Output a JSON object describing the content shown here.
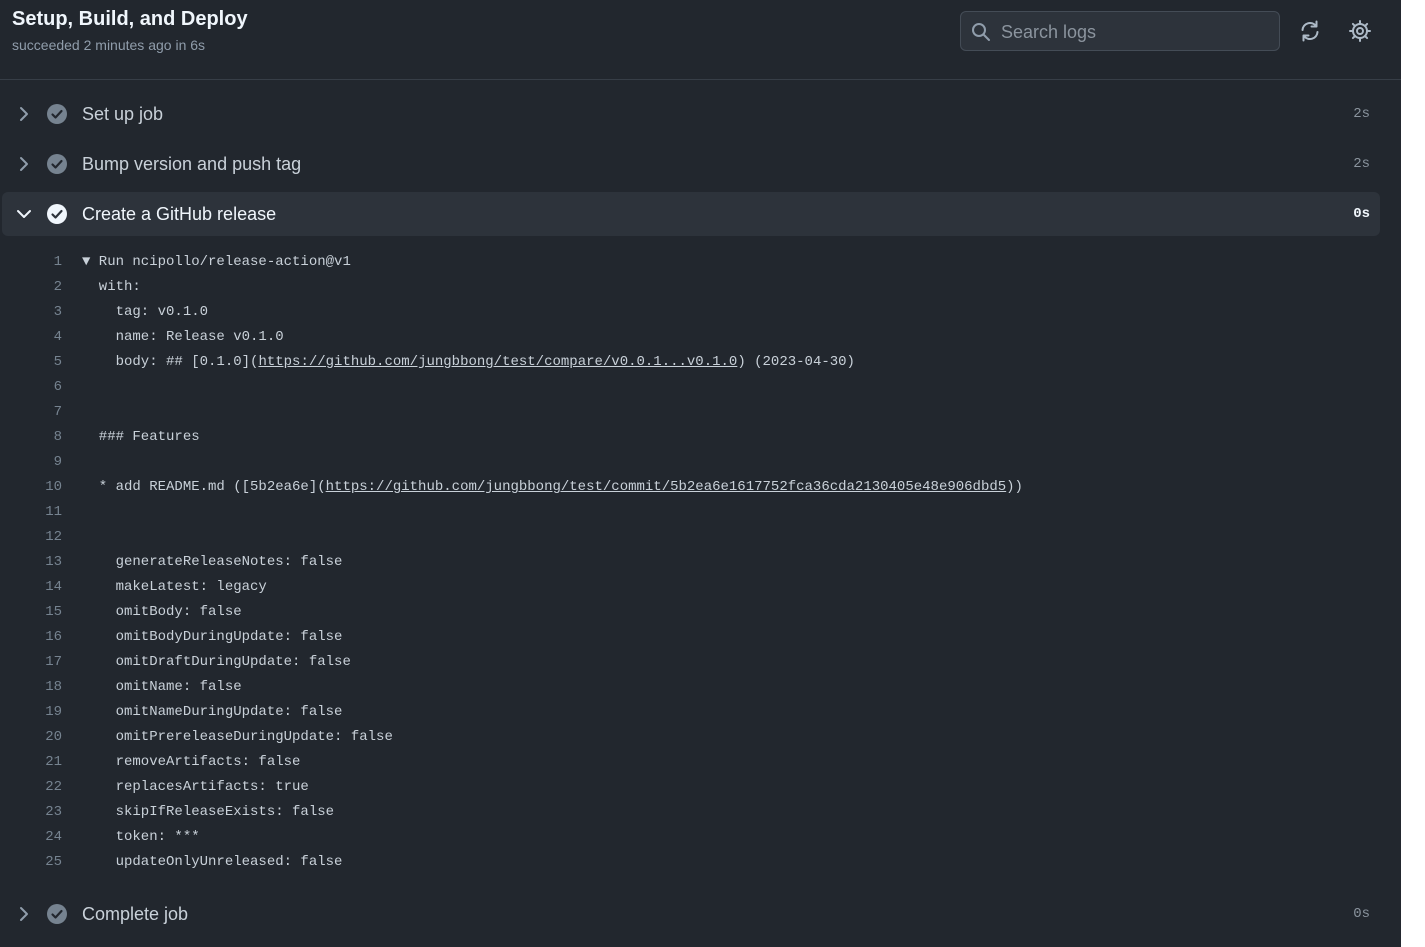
{
  "header": {
    "title": "Setup, Build, and Deploy",
    "status": "succeeded",
    "ago": "2 minutes ago",
    "in_word": "in",
    "duration": "6s",
    "search_placeholder": "Search logs",
    "icons": {
      "search": "search-icon",
      "refresh": "refresh-icon",
      "settings": "gear-icon"
    }
  },
  "colors": {
    "background": "#22272e",
    "success": "#768390",
    "expanded_bg": "#2d333b"
  },
  "steps": [
    {
      "name": "Set up job",
      "time": "2s",
      "expanded": false
    },
    {
      "name": "Bump version and push tag",
      "time": "2s",
      "expanded": false
    },
    {
      "name": "Create a GitHub release",
      "time": "0s",
      "expanded": true
    },
    {
      "name": "Complete job",
      "time": "0s",
      "expanded": false
    }
  ],
  "log": [
    {
      "n": "1",
      "parts": [
        {
          "t": "▼ Run ncipollo/release-action@v1"
        }
      ]
    },
    {
      "n": "2",
      "parts": [
        {
          "t": "  with:"
        }
      ]
    },
    {
      "n": "3",
      "parts": [
        {
          "t": "    tag: v0.1.0"
        }
      ]
    },
    {
      "n": "4",
      "parts": [
        {
          "t": "    name: Release v0.1.0"
        }
      ]
    },
    {
      "n": "5",
      "parts": [
        {
          "t": "    body: ## [0.1.0]("
        },
        {
          "t": "https://github.com/jungbbong/test/compare/v0.0.1...v0.1.0",
          "link": true
        },
        {
          "t": ") (2023-04-30)"
        }
      ]
    },
    {
      "n": "6",
      "parts": [
        {
          "t": ""
        }
      ]
    },
    {
      "n": "7",
      "parts": [
        {
          "t": ""
        }
      ]
    },
    {
      "n": "8",
      "parts": [
        {
          "t": "  ### Features"
        }
      ]
    },
    {
      "n": "9",
      "parts": [
        {
          "t": ""
        }
      ]
    },
    {
      "n": "10",
      "parts": [
        {
          "t": "  * add README.md ([5b2ea6e]("
        },
        {
          "t": "https://github.com/jungbbong/test/commit/5b2ea6e1617752fca36cda2130405e48e906dbd5",
          "link": true
        },
        {
          "t": "))"
        }
      ]
    },
    {
      "n": "11",
      "parts": [
        {
          "t": ""
        }
      ]
    },
    {
      "n": "12",
      "parts": [
        {
          "t": ""
        }
      ]
    },
    {
      "n": "13",
      "parts": [
        {
          "t": "    generateReleaseNotes: false"
        }
      ]
    },
    {
      "n": "14",
      "parts": [
        {
          "t": "    makeLatest: legacy"
        }
      ]
    },
    {
      "n": "15",
      "parts": [
        {
          "t": "    omitBody: false"
        }
      ]
    },
    {
      "n": "16",
      "parts": [
        {
          "t": "    omitBodyDuringUpdate: false"
        }
      ]
    },
    {
      "n": "17",
      "parts": [
        {
          "t": "    omitDraftDuringUpdate: false"
        }
      ]
    },
    {
      "n": "18",
      "parts": [
        {
          "t": "    omitName: false"
        }
      ]
    },
    {
      "n": "19",
      "parts": [
        {
          "t": "    omitNameDuringUpdate: false"
        }
      ]
    },
    {
      "n": "20",
      "parts": [
        {
          "t": "    omitPrereleaseDuringUpdate: false"
        }
      ]
    },
    {
      "n": "21",
      "parts": [
        {
          "t": "    removeArtifacts: false"
        }
      ]
    },
    {
      "n": "22",
      "parts": [
        {
          "t": "    replacesArtifacts: true"
        }
      ]
    },
    {
      "n": "23",
      "parts": [
        {
          "t": "    skipIfReleaseExists: false"
        }
      ]
    },
    {
      "n": "24",
      "parts": [
        {
          "t": "    token: ***"
        }
      ]
    },
    {
      "n": "25",
      "parts": [
        {
          "t": "    updateOnlyUnreleased: false"
        }
      ]
    }
  ]
}
